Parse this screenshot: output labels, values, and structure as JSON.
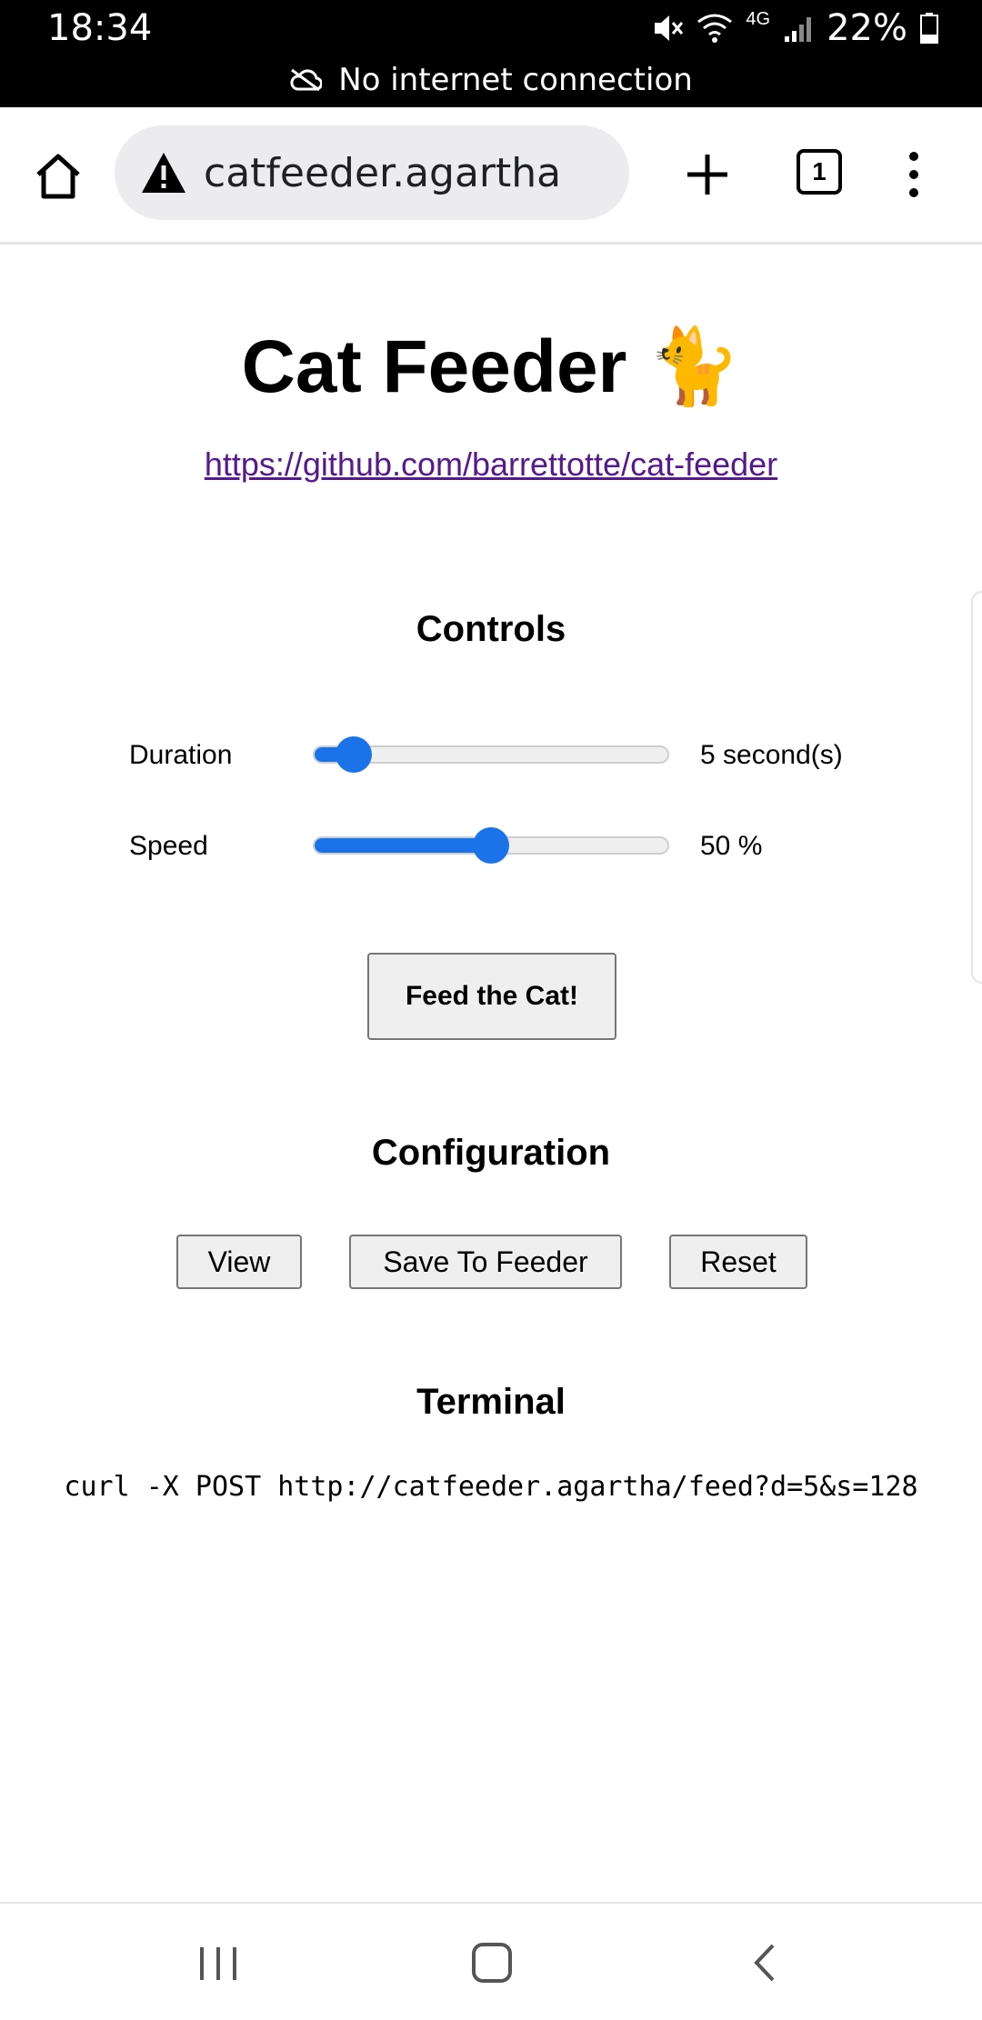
{
  "status_bar": {
    "time": "18:34",
    "battery": "22%",
    "network": "4G",
    "offline_message": "No internet connection"
  },
  "browser": {
    "url": "catfeeder.agartha",
    "tab_count": "1"
  },
  "page": {
    "title": "Cat Feeder 🐈",
    "repo_link": "https://github.com/barrettotte/cat-feeder",
    "controls_heading": "Controls",
    "duration": {
      "label": "Duration",
      "value_text": "5 second(s)",
      "level_fraction": 0.11
    },
    "speed": {
      "label": "Speed",
      "value_text": "50 %",
      "level_fraction": 0.5
    },
    "feed_button": "Feed the Cat!",
    "configuration_heading": "Configuration",
    "config_buttons": {
      "view": "View",
      "save": "Save To Feeder",
      "reset": "Reset"
    },
    "terminal_heading": "Terminal",
    "terminal_command": "curl -X POST http://catfeeder.agartha/feed?d=5&s=128"
  },
  "colors": {
    "accent": "#1a73e8",
    "link_visited": "#551a8b",
    "status_bar_bg": "#000000"
  },
  "icons": [
    "mute-icon",
    "wifi-icon",
    "signal-icon",
    "battery-icon",
    "cloud-off-icon",
    "home-icon",
    "warning-icon",
    "plus-icon",
    "tabs-icon",
    "more-vert-icon",
    "recent-apps-icon",
    "nav-home-icon",
    "back-icon"
  ]
}
